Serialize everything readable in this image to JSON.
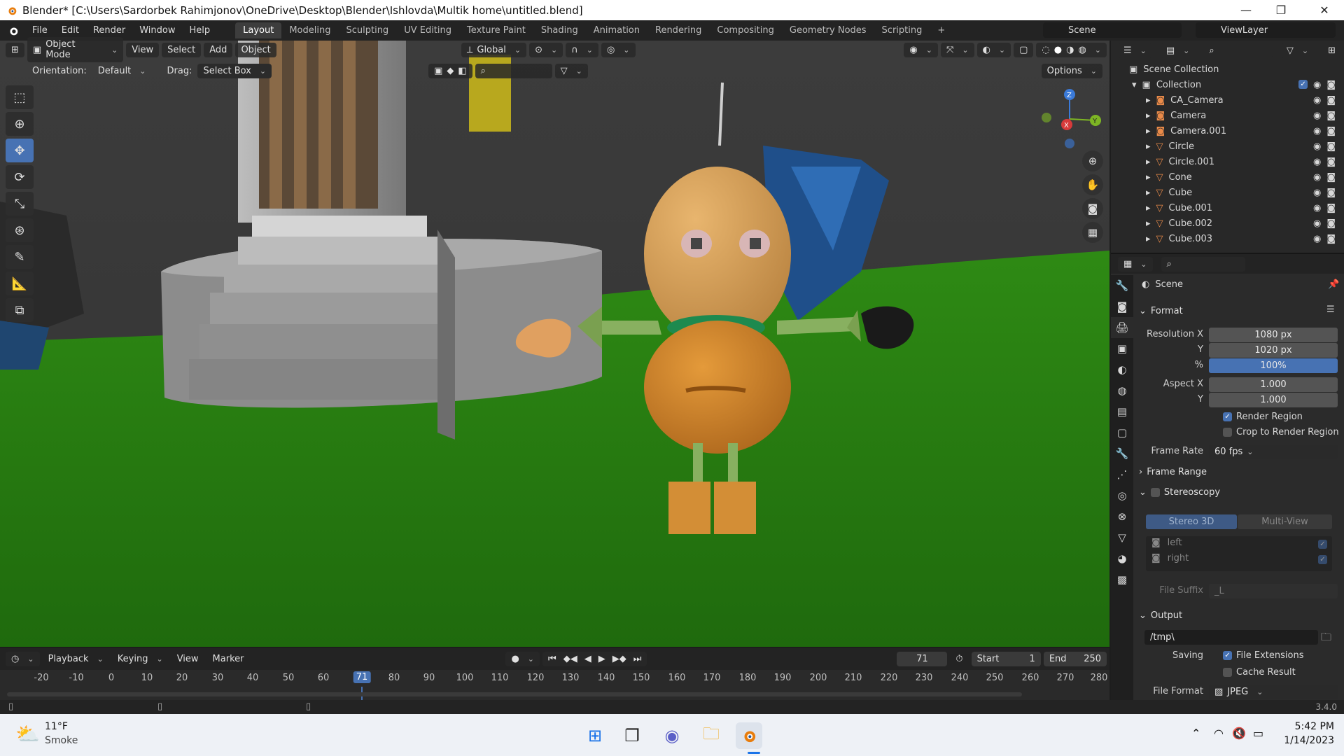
{
  "window": {
    "title": "Blender* [C:\\Users\\Sardorbek Rahimjonov\\OneDrive\\Desktop\\Blender\\Ishlovda\\Multik home\\untitled.blend]",
    "minimize": "—",
    "maximize": "❐",
    "close": "✕"
  },
  "menus": [
    "File",
    "Edit",
    "Render",
    "Window",
    "Help"
  ],
  "workspaces": [
    "Layout",
    "Modeling",
    "Sculpting",
    "UV Editing",
    "Texture Paint",
    "Shading",
    "Animation",
    "Rendering",
    "Compositing",
    "Geometry Nodes",
    "Scripting"
  ],
  "workspace_add": "+",
  "scene_selector": "Scene",
  "viewlayer_selector": "ViewLayer",
  "viewport": {
    "mode": "Object Mode",
    "menus": [
      "View",
      "Select",
      "Add",
      "Object"
    ],
    "transform": "Global",
    "orientation_label": "Orientation:",
    "orientation_value": "Default",
    "drag_label": "Drag:",
    "drag_value": "Select Box",
    "options": "Options",
    "gizmo": {
      "x": "X",
      "y": "Y",
      "z": "Z"
    }
  },
  "timeline": {
    "menus": [
      "Playback",
      "Keying",
      "View",
      "Marker"
    ],
    "current_frame": "71",
    "start_label": "Start",
    "start": "1",
    "end_label": "End",
    "end": "250",
    "ticks": [
      "-20",
      "-10",
      "0",
      "10",
      "20",
      "30",
      "40",
      "50",
      "60",
      "80",
      "90",
      "100",
      "110",
      "120",
      "130",
      "140",
      "150",
      "160",
      "170",
      "180",
      "190",
      "200",
      "210",
      "220",
      "230",
      "240",
      "250",
      "260",
      "270",
      "280"
    ]
  },
  "outliner": {
    "root": "Scene Collection",
    "collection": "Collection",
    "items": [
      "CA_Camera",
      "Camera",
      "Camera.001",
      "Circle",
      "Circle.001",
      "Cone",
      "Cube",
      "Cube.001",
      "Cube.002",
      "Cube.003"
    ]
  },
  "properties": {
    "context": "Scene",
    "format": {
      "title": "Format",
      "res_x_label": "Resolution X",
      "res_x": "1080 px",
      "res_y_label": "Y",
      "res_y": "1020 px",
      "pct_label": "%",
      "pct": "100%",
      "aspect_x_label": "Aspect X",
      "aspect_x": "1.000",
      "aspect_y_label": "Y",
      "aspect_y": "1.000",
      "render_region": "Render Region",
      "crop_region": "Crop to Render Region",
      "frame_rate_label": "Frame Rate",
      "frame_rate": "60 fps"
    },
    "frame_range": "Frame Range",
    "stereoscopy": {
      "title": "Stereoscopy",
      "stereo3d": "Stereo 3D",
      "multiview": "Multi-View",
      "left": "left",
      "right": "right",
      "suffix_label": "File Suffix",
      "suffix": "_L"
    },
    "output": {
      "title": "Output",
      "path": "/tmp\\",
      "saving_label": "Saving",
      "file_ext": "File Extensions",
      "cache": "Cache Result",
      "format_label": "File Format",
      "format": "JPEG"
    }
  },
  "statusbar": {
    "version": "3.4.0"
  },
  "taskbar": {
    "temp": "11°F",
    "weather": "Smoke",
    "time": "5:42 PM",
    "date": "1/14/2023"
  }
}
